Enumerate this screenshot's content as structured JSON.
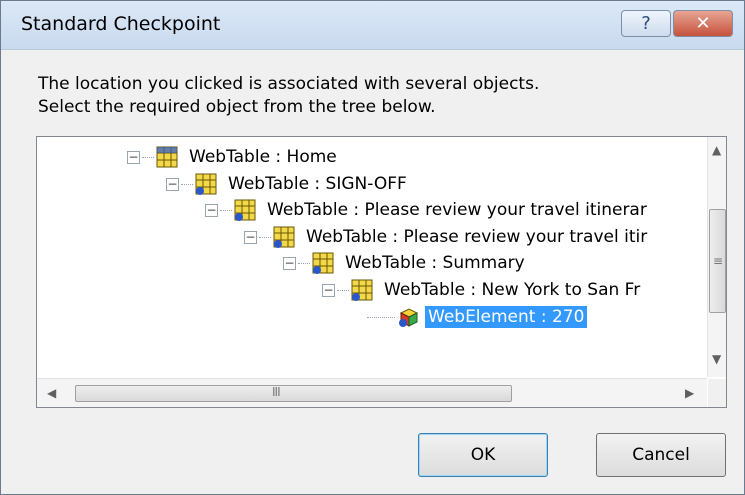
{
  "window": {
    "title": "Standard Checkpoint",
    "help_label": "?",
    "close_label": "✕"
  },
  "message": {
    "line1": "The location you clicked is associated with several objects.",
    "line2": "Select the required object from the tree below."
  },
  "tree": {
    "items": [
      {
        "label": "WebTable : Home"
      },
      {
        "label": "WebTable : SIGN-OFF"
      },
      {
        "label": "WebTable : Please review your travel itinerar"
      },
      {
        "label": "WebTable : Please review your travel itir"
      },
      {
        "label": "WebTable : Summary"
      },
      {
        "label": "WebTable : New York to San Fr"
      },
      {
        "label": "WebElement : 270",
        "selected": true
      }
    ]
  },
  "buttons": {
    "ok": "OK",
    "cancel": "Cancel"
  },
  "icons": {
    "table": "webtable-icon",
    "element": "webelement-icon"
  }
}
